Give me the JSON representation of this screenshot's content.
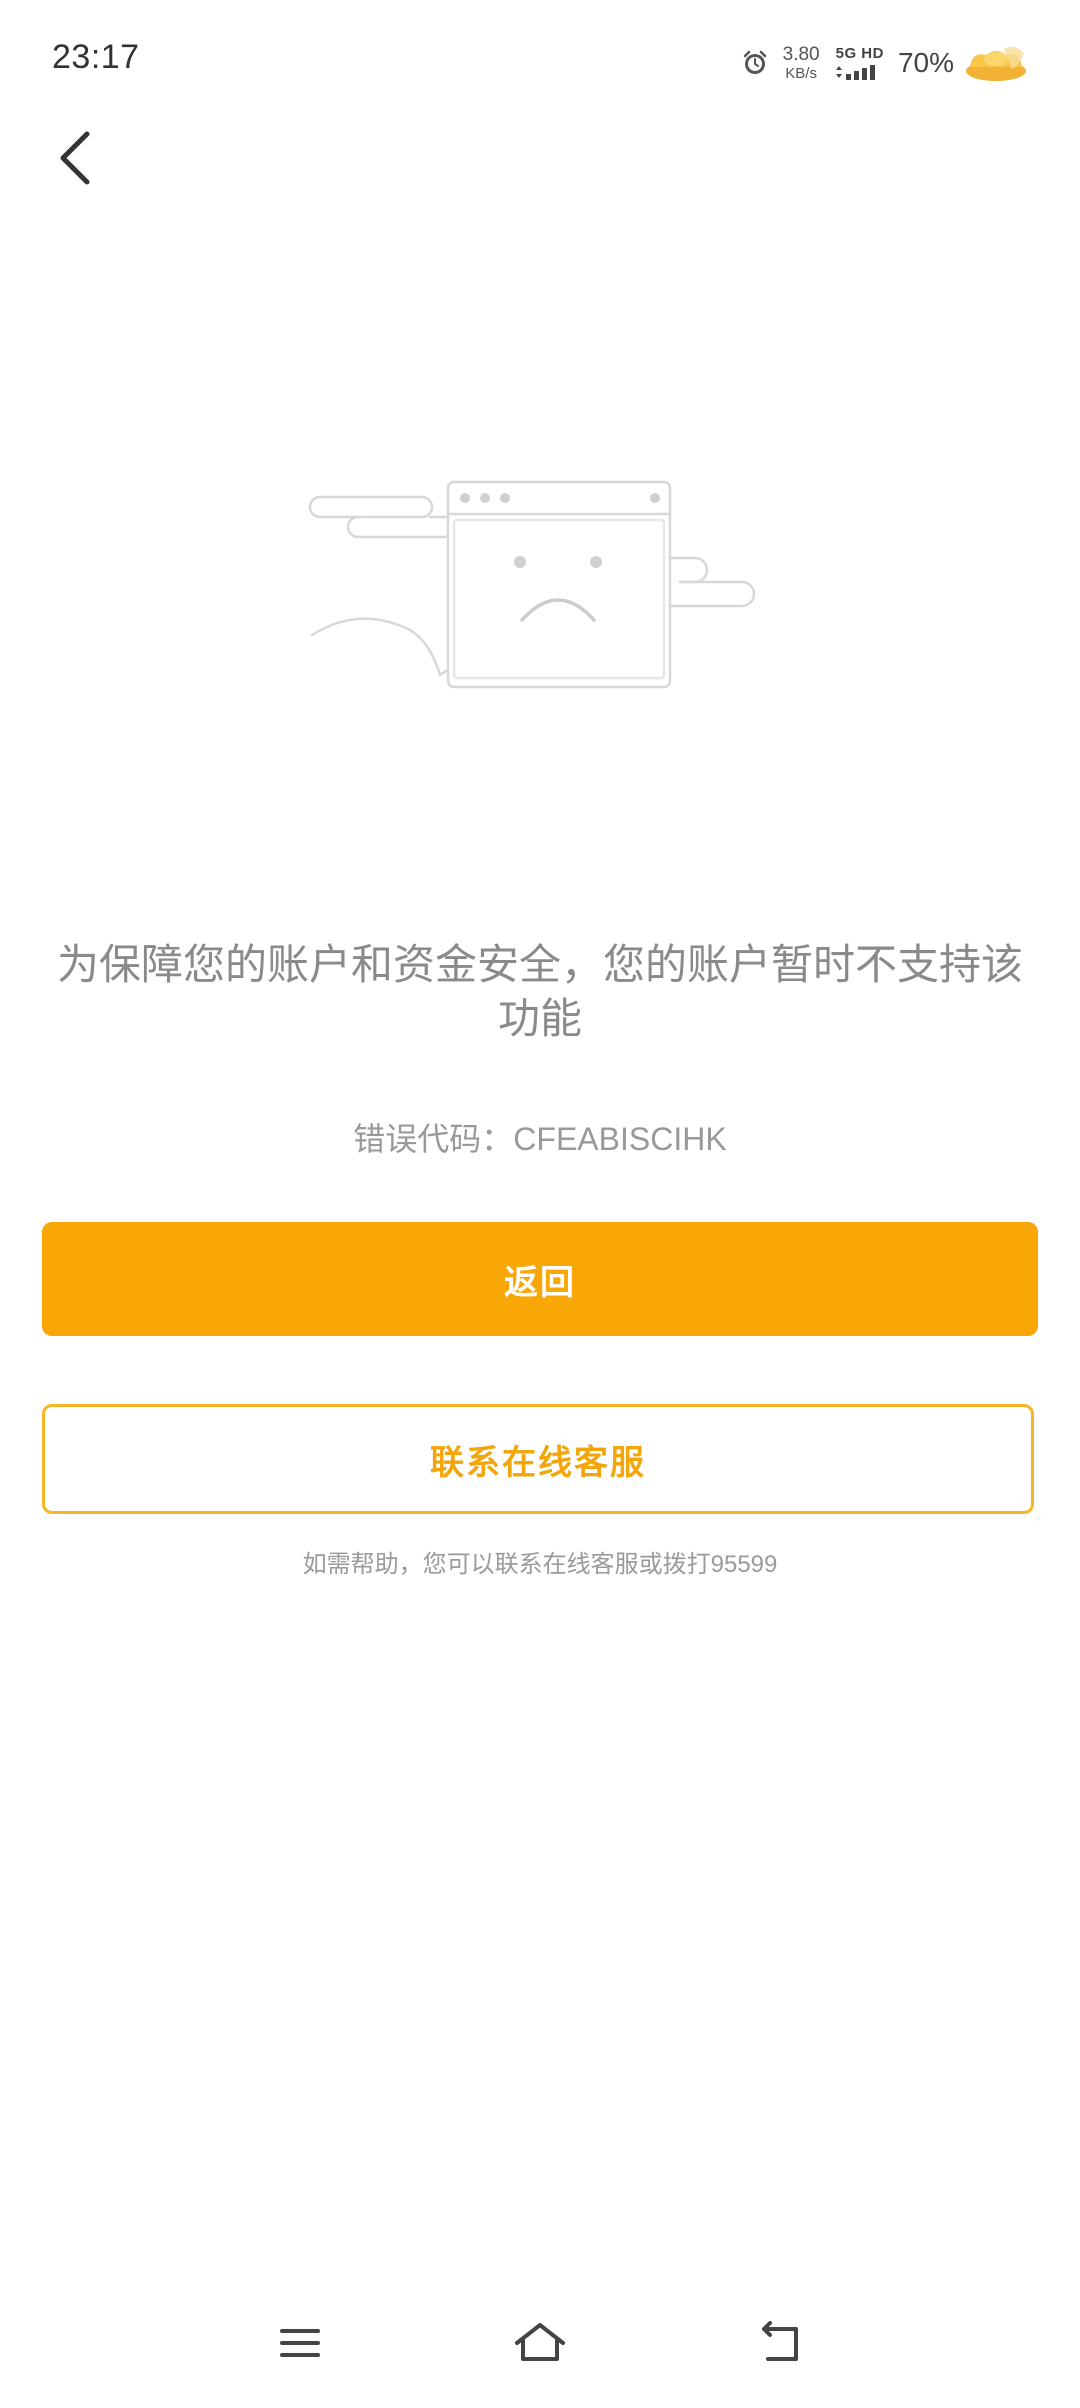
{
  "status_bar": {
    "time": "23:17",
    "net_speed_value": "3.80",
    "net_speed_unit": "KB/s",
    "network_type": "5G HD",
    "battery": "70%",
    "icons": [
      "alarm-icon",
      "signal-icon",
      "gold-ingot-icon"
    ]
  },
  "header": {
    "back_icon": "chevron-left-icon"
  },
  "illustration": {
    "icon": "sad-browser-window-illustration"
  },
  "message": {
    "text": "为保障您的账户和资金安全，您的账户暂时不支持该功能",
    "error_code": "错误代码：CFEABISCIHK"
  },
  "actions": {
    "primary_label": "返回",
    "secondary_label": "联系在线客服",
    "help_text": "如需帮助，您可以联系在线客服或拨打95599"
  },
  "colors": {
    "primary": "#f9a707",
    "secondary_border": "#f5b524",
    "secondary_text": "#f3a60c",
    "message_text": "#8a8a8a"
  },
  "nav_bar": {
    "icons": [
      "menu-icon",
      "home-icon",
      "back-icon"
    ]
  }
}
